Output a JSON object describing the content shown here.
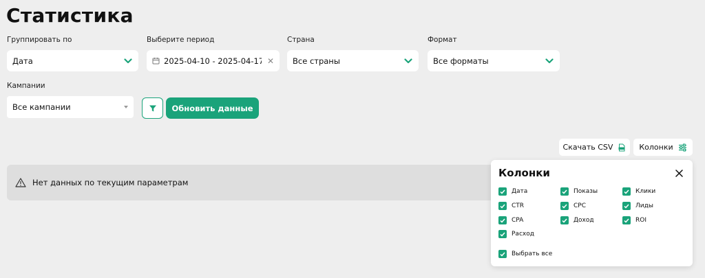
{
  "page": {
    "title": "Статистика"
  },
  "filters": {
    "group_by": {
      "label": "Группировать по",
      "value": "Дата"
    },
    "period": {
      "label": "Выберите период",
      "value": "2025-04-10 - 2025-04-17"
    },
    "country": {
      "label": "Страна",
      "value": "Все страны"
    },
    "format": {
      "label": "Формат",
      "value": "Все форматы"
    },
    "campaigns": {
      "label": "Кампании",
      "value": "Все кампании"
    }
  },
  "actions": {
    "refresh_label": "Обновить данные",
    "download_csv_label": "Скачать CSV",
    "columns_label": "Колонки"
  },
  "notice": {
    "text": "Нет данных по текущим параметрам"
  },
  "columns_panel": {
    "title": "Колонки",
    "items": [
      {
        "label": "Дата",
        "checked": true
      },
      {
        "label": "Показы",
        "checked": true
      },
      {
        "label": "Клики",
        "checked": true
      },
      {
        "label": "CTR",
        "checked": true
      },
      {
        "label": "CPC",
        "checked": true
      },
      {
        "label": "Лиды",
        "checked": true
      },
      {
        "label": "CPA",
        "checked": true
      },
      {
        "label": "Доход",
        "checked": true
      },
      {
        "label": "ROI",
        "checked": true
      },
      {
        "label": "Расход",
        "checked": true
      }
    ],
    "select_all_label": "Выбрать все"
  },
  "colors": {
    "accent": "#1aa37a",
    "background": "#eeeeee",
    "notice_bg": "#dedede"
  }
}
